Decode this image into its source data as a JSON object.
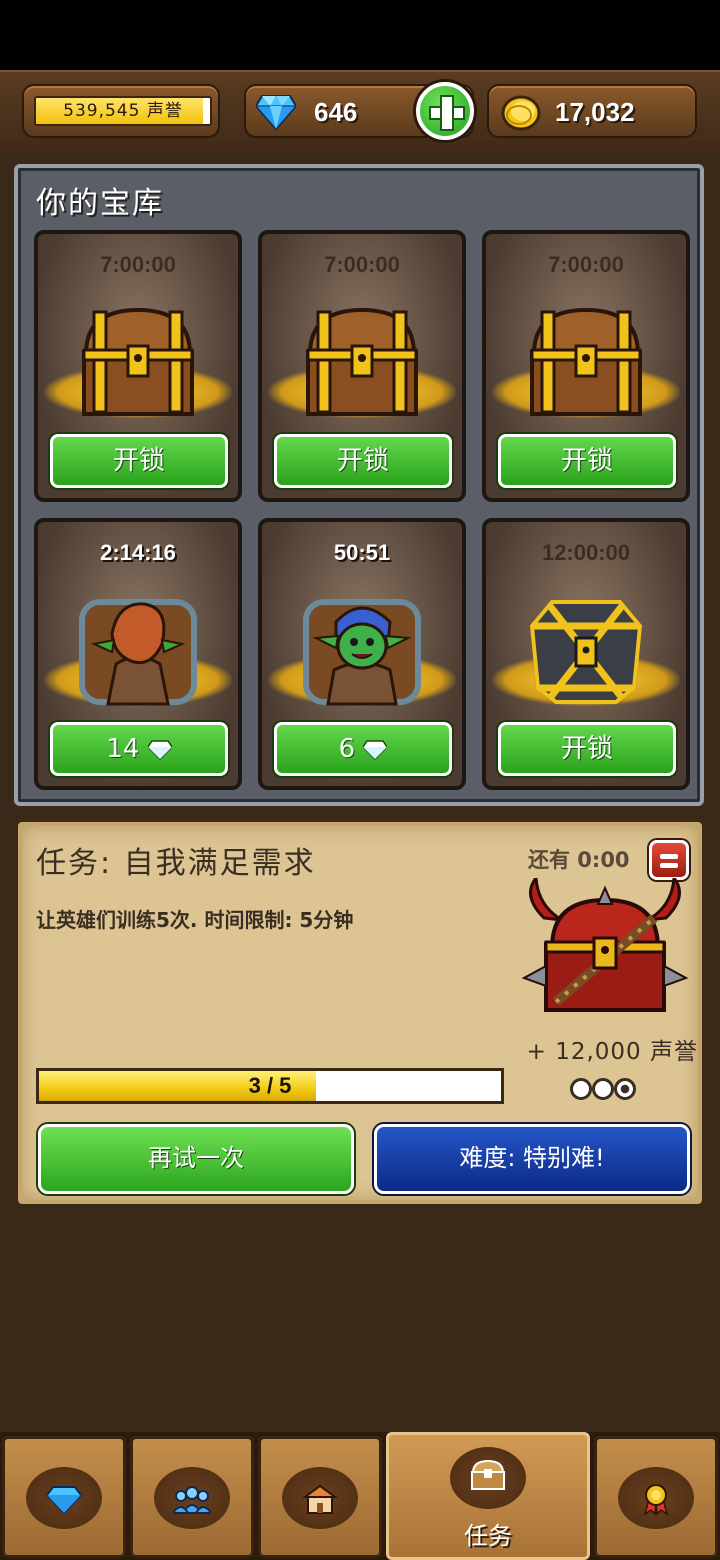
{
  "colors": {
    "accent_green": "#2aa21c",
    "accent_blue": "#0c2a86",
    "gold": "#f2c10c",
    "wood": "#5b3a1b"
  },
  "header": {
    "reputation_label": "539,545 声誉",
    "reputation_progress": 0.96,
    "gems": "646",
    "gold": "17,032",
    "icons": {
      "gem": "diamond-icon",
      "plus": "plus-icon",
      "gold": "gold-coin-icon"
    }
  },
  "vault": {
    "title": "你的宝库",
    "slots": [
      {
        "timer": "7:00:00",
        "content": "wooden-chest",
        "button_label": "开锁",
        "active": false
      },
      {
        "timer": "7:00:00",
        "content": "wooden-chest",
        "button_label": "开锁",
        "active": false
      },
      {
        "timer": "7:00:00",
        "content": "wooden-chest",
        "button_label": "开锁",
        "active": false
      },
      {
        "timer": "2:14:16",
        "content": "goblin-red-hood-opening",
        "button_value": "14",
        "active": true
      },
      {
        "timer": "50:51",
        "content": "goblin-blue-hood-opening",
        "button_value": "6",
        "active": true
      },
      {
        "timer": "12:00:00",
        "content": "iron-gold-chest",
        "button_label": "开锁",
        "active": false
      }
    ]
  },
  "quest": {
    "title": "任务: 自我满足需求",
    "time_left": "还有 0:00",
    "description": "让英雄们训练5次. 时间限制: 5分钟",
    "reward": "+ 12,000 声誉",
    "progress_text": "3 / 5",
    "progress_value": 3,
    "progress_max": 5,
    "stars": [
      false,
      false,
      true
    ],
    "retry_label": "再试一次",
    "difficulty_label": "难度: 特别难!"
  },
  "nav": {
    "tabs": [
      {
        "icon": "gem-shop-icon",
        "label": ""
      },
      {
        "icon": "heroes-icon",
        "label": ""
      },
      {
        "icon": "town-icon",
        "label": ""
      },
      {
        "icon": "quest-chest-icon",
        "label": "任务",
        "active": true
      },
      {
        "icon": "achievement-icon",
        "label": ""
      }
    ]
  }
}
